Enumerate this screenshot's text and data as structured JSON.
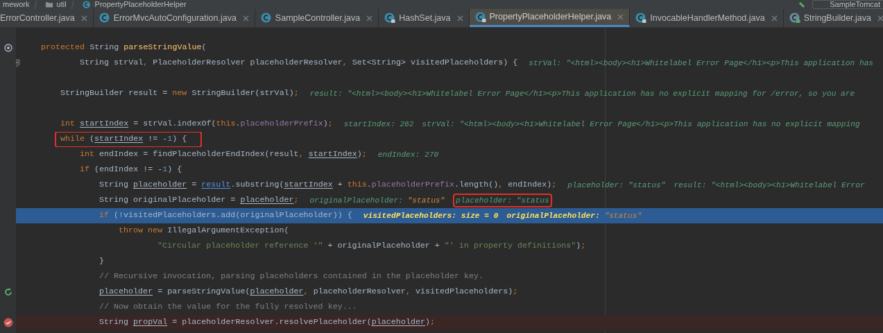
{
  "breadcrumb": {
    "items": [
      {
        "text": "mework"
      },
      {
        "text": "util",
        "kind": "folder"
      },
      {
        "text": "PropertyPlaceholderHelper",
        "kind": "class"
      }
    ],
    "run_config": "SampleTomcat"
  },
  "tabs": [
    {
      "label": "ErrorController.java",
      "selected": false
    },
    {
      "label": "ErrorMvcAutoConfiguration.java",
      "kind": "class",
      "selected": false
    },
    {
      "label": "SampleController.java",
      "kind": "class",
      "selected": false
    },
    {
      "label": "HashSet.java",
      "kind": "class-locked",
      "selected": false
    },
    {
      "label": "PropertyPlaceholderHelper.java",
      "kind": "class-locked",
      "selected": true
    },
    {
      "label": "InvocableHandlerMethod.java",
      "kind": "class-locked",
      "selected": false
    },
    {
      "label": "StringBuilder.java",
      "kind": "library",
      "selected": false
    }
  ],
  "lines": [
    {
      "kind": "override",
      "tokens": [
        {
          "kind": "kw",
          "text": "protected "
        },
        {
          "kind": "plain",
          "text": "String "
        },
        {
          "kind": "fn",
          "text": "parseStringValue"
        },
        {
          "kind": "plain",
          "text": "("
        }
      ],
      "children": [
        {
          "kind": "fold",
          "continuation": true,
          "tokens": [
            {
              "kind": "plain",
              "text": "String strVal"
            },
            {
              "kind": "punct",
              "text": ", "
            },
            {
              "kind": "plain",
              "text": "PlaceholderResolver placeholderResolver"
            },
            {
              "kind": "punct",
              "text": ", "
            },
            {
              "kind": "plain",
              "text": "Set<String> visitedPlaceholders) {"
            }
          ],
          "hints": [
            {
              "label": "strVal:",
              "value": "\"<html><body><h1>Whitelabel Error Page</h1><p>This application has"
            }
          ]
        },
        {
          "kind": "blank"
        },
        {
          "tokens": [
            {
              "kind": "plain",
              "text": "StringBuilder result = "
            },
            {
              "kind": "kw",
              "text": "new "
            },
            {
              "kind": "plain",
              "text": "StringBuilder(strVal)"
            },
            {
              "kind": "punct",
              "text": ";"
            }
          ],
          "hints": [
            {
              "label": "result:",
              "value": "\"<html><body><h1>Whitelabel Error Page</h1><p>This application has no explicit mapping for /error, so you are"
            }
          ]
        },
        {
          "kind": "blank"
        },
        {
          "tokens": [
            {
              "kind": "kw",
              "text": "int "
            },
            {
              "kind": "var",
              "text": "startIndex"
            },
            {
              "kind": "plain",
              "text": " = strVal.indexOf("
            },
            {
              "kind": "kw",
              "text": "this"
            },
            {
              "kind": "plain",
              "text": "."
            },
            {
              "kind": "field",
              "text": "placeholderPrefix"
            },
            {
              "kind": "plain",
              "text": ")"
            },
            {
              "kind": "punct",
              "text": ";"
            }
          ],
          "hints": [
            {
              "label": "startIndex:",
              "value": "262"
            },
            {
              "label": "strVal:",
              "value": "\"<html><body><h1>Whitelabel Error Page</h1><p>This application has no explicit mapping"
            }
          ]
        },
        {
          "boxed": true,
          "tokens": [
            {
              "kind": "kw",
              "text": "while "
            },
            {
              "kind": "plain",
              "text": "("
            },
            {
              "kind": "var",
              "text": "startIndex"
            },
            {
              "kind": "plain",
              "text": " != -"
            },
            {
              "kind": "num",
              "text": "1"
            },
            {
              "kind": "plain",
              "text": ") {"
            }
          ],
          "children": [
            {
              "tokens": [
                {
                  "kind": "kw",
                  "text": "int "
                },
                {
                  "kind": "plain",
                  "text": "endIndex = findPlaceholderEndIndex(result"
                },
                {
                  "kind": "punct",
                  "text": ", "
                },
                {
                  "kind": "var",
                  "text": "startIndex"
                },
                {
                  "kind": "plain",
                  "text": ")"
                },
                {
                  "kind": "punct",
                  "text": ";"
                }
              ],
              "hints": [
                {
                  "label": "endIndex:",
                  "value": "270"
                }
              ]
            },
            {
              "tokens": [
                {
                  "kind": "kw",
                  "text": "if "
                },
                {
                  "kind": "plain",
                  "text": "(endIndex != -"
                },
                {
                  "kind": "num",
                  "text": "1"
                },
                {
                  "kind": "plain",
                  "text": ") {"
                }
              ],
              "children": [
                {
                  "tokens": [
                    {
                      "kind": "plain",
                      "text": "String "
                    },
                    {
                      "kind": "var",
                      "text": "placeholder"
                    },
                    {
                      "kind": "plain",
                      "text": " = "
                    },
                    {
                      "kind": "ref",
                      "text": "result"
                    },
                    {
                      "kind": "plain",
                      "text": ".substring("
                    },
                    {
                      "kind": "var",
                      "text": "startIndex"
                    },
                    {
                      "kind": "plain",
                      "text": " + "
                    },
                    {
                      "kind": "kw",
                      "text": "this"
                    },
                    {
                      "kind": "plain",
                      "text": "."
                    },
                    {
                      "kind": "field",
                      "text": "placeholderPrefix"
                    },
                    {
                      "kind": "plain",
                      "text": ".length()"
                    },
                    {
                      "kind": "punct",
                      "text": ", "
                    },
                    {
                      "kind": "plain",
                      "text": "endIndex)"
                    },
                    {
                      "kind": "punct",
                      "text": ";"
                    }
                  ],
                  "hints": [
                    {
                      "label": "placeholder:",
                      "value": "\"status\""
                    },
                    {
                      "label": "result:",
                      "value": "\"<html><body><h1>Whitelabel Error"
                    }
                  ]
                },
                {
                  "tokens": [
                    {
                      "kind": "plain",
                      "text": "String originalPlaceholder = "
                    },
                    {
                      "kind": "var",
                      "text": "placeholder"
                    },
                    {
                      "kind": "punct",
                      "text": ";"
                    }
                  ],
                  "hints": [
                    {
                      "label": "originalPlaceholder:",
                      "value": "\"status\"",
                      "changed": true
                    },
                    {
                      "label": "placeholder:",
                      "value": "\"status",
                      "boxed": true
                    }
                  ]
                },
                {
                  "current": true,
                  "tokens": [
                    {
                      "kind": "kw",
                      "text": "if "
                    },
                    {
                      "kind": "plain",
                      "text": "(!visitedPlaceholders.add(originalPlaceholder)) {"
                    }
                  ],
                  "hints": [
                    {
                      "label": "visitedPlaceholders:",
                      "value": "size = 0"
                    },
                    {
                      "label": "originalPlaceholder:",
                      "value": "\"status\"",
                      "changed": true
                    }
                  ],
                  "children": [
                    {
                      "tokens": [
                        {
                          "kind": "kw",
                          "text": "throw new "
                        },
                        {
                          "kind": "plain",
                          "text": "IllegalArgumentException("
                        }
                      ],
                      "children": [
                        {
                          "continuation": true,
                          "tokens": [
                            {
                              "kind": "str",
                              "text": "\"Circular placeholder reference '\""
                            },
                            {
                              "kind": "plain",
                              "text": " + originalPlaceholder + "
                            },
                            {
                              "kind": "str",
                              "text": "\"' in property definitions\""
                            },
                            {
                              "kind": "plain",
                              "text": ")"
                            },
                            {
                              "kind": "punct",
                              "text": ";"
                            }
                          ]
                        }
                      ]
                    }
                  ]
                },
                {
                  "tokens": [
                    {
                      "kind": "plain",
                      "text": "}"
                    }
                  ]
                },
                {
                  "tokens": [
                    {
                      "kind": "comment",
                      "text": "// Recursive invocation, parsing placeholders contained in the placeholder key."
                    }
                  ]
                },
                {
                  "kind": "recursion",
                  "tokens": [
                    {
                      "kind": "var",
                      "text": "placeholder"
                    },
                    {
                      "kind": "plain",
                      "text": " = parseStringValue("
                    },
                    {
                      "kind": "var",
                      "text": "placeholder"
                    },
                    {
                      "kind": "punct",
                      "text": ", "
                    },
                    {
                      "kind": "plain",
                      "text": "placeholderResolver"
                    },
                    {
                      "kind": "punct",
                      "text": ", "
                    },
                    {
                      "kind": "plain",
                      "text": "visitedPlaceholders)"
                    },
                    {
                      "kind": "punct",
                      "text": ";"
                    }
                  ]
                },
                {
                  "tokens": [
                    {
                      "kind": "comment",
                      "text": "// Now obtain the value for the fully resolved key..."
                    }
                  ]
                },
                {
                  "breakpoint": true,
                  "tokens": [
                    {
                      "kind": "plain",
                      "text": "String "
                    },
                    {
                      "kind": "var",
                      "text": "propVal"
                    },
                    {
                      "kind": "plain",
                      "text": " = placeholderResolver.resolvePlaceholder("
                    },
                    {
                      "kind": "var",
                      "text": "placeholder"
                    },
                    {
                      "kind": "plain",
                      "text": ")"
                    },
                    {
                      "kind": "punct",
                      "text": ";"
                    }
                  ]
                }
              ]
            }
          ]
        }
      ]
    }
  ]
}
